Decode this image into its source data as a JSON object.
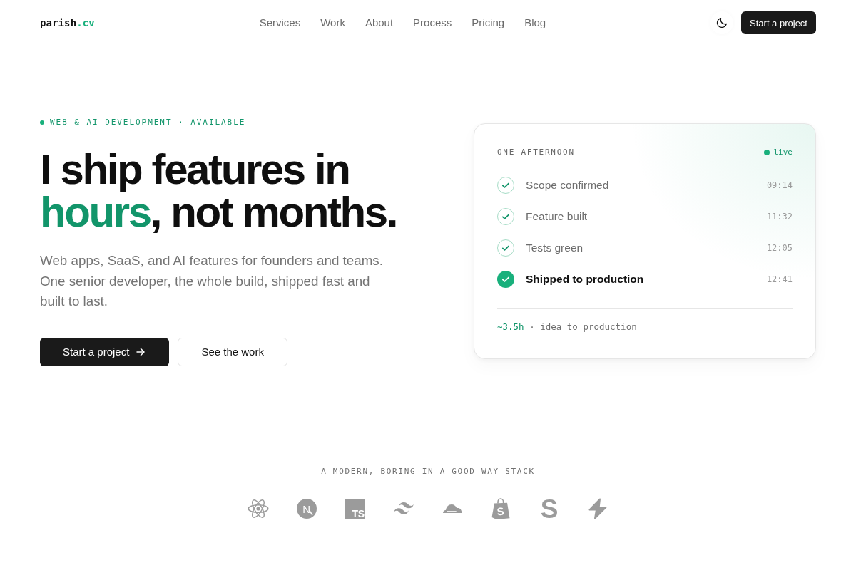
{
  "header": {
    "logo": {
      "name": "parish",
      "suffix": ".cv"
    },
    "nav": [
      "Services",
      "Work",
      "About",
      "Process",
      "Pricing",
      "Blog"
    ],
    "cta": "Start a project"
  },
  "hero": {
    "eyebrow": "WEB & AI DEVELOPMENT · AVAILABLE",
    "headline": {
      "lead": "I ship features in",
      "accent": "hours",
      "tail": ", not months."
    },
    "lead": "Web apps, SaaS, and AI features for founders and teams. One senior developer, the whole build, shipped fast and built to last.",
    "buttons": [
      {
        "label": "Start a project",
        "kind": "primary"
      },
      {
        "label": "See the work",
        "kind": "secondary"
      }
    ]
  },
  "card": {
    "title": "ONE AFTERNOON",
    "status": "live",
    "steps": [
      {
        "label": "Scope confirmed",
        "time": "09:14",
        "done": true,
        "current": false
      },
      {
        "label": "Feature built",
        "time": "11:32",
        "done": true,
        "current": false
      },
      {
        "label": "Tests green",
        "time": "12:05",
        "done": true,
        "current": false
      },
      {
        "label": "Shipped to production",
        "time": "12:41",
        "done": true,
        "current": true
      }
    ],
    "summary": {
      "value": "~3.5h",
      "label": "· idea to production"
    }
  },
  "stack": {
    "title": "A MODERN, BORING-IN-A-GOOD-WAY STACK",
    "logos": [
      {
        "kind": "atom"
      },
      {
        "kind": "letter-circle",
        "mark": "N"
      },
      {
        "kind": "tile",
        "mark": "TS"
      },
      {
        "kind": "waves"
      },
      {
        "kind": "cloud"
      },
      {
        "kind": "bag",
        "mark": "S"
      },
      {
        "kind": "letter",
        "mark": "S"
      },
      {
        "kind": "bolt"
      }
    ]
  }
}
